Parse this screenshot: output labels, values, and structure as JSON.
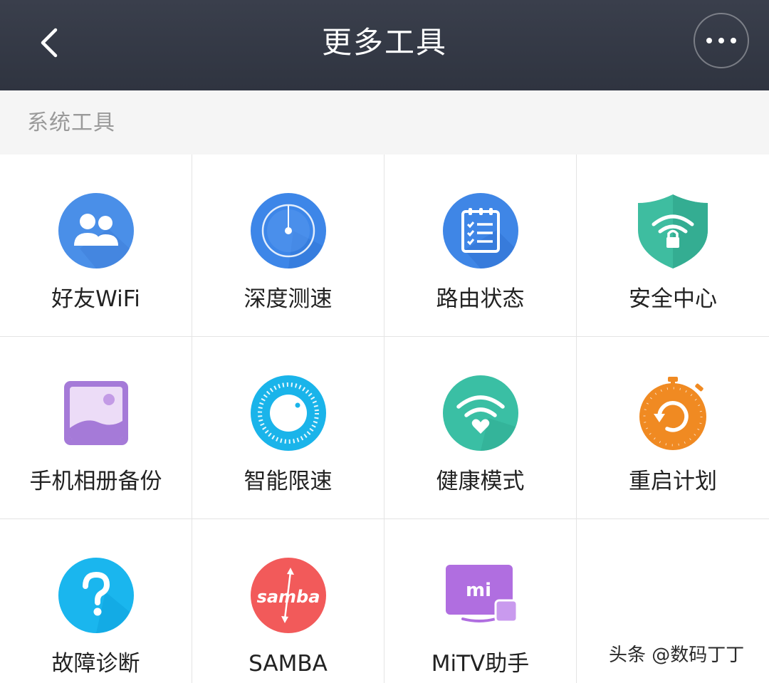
{
  "header": {
    "title": "更多工具"
  },
  "section": {
    "title": "系统工具"
  },
  "tools": [
    {
      "label": "好友WiFi",
      "icon": "friends-icon",
      "color": "#4a8fe8"
    },
    {
      "label": "深度测速",
      "icon": "radar-icon",
      "color": "#3d86e8"
    },
    {
      "label": "路由状态",
      "icon": "clipboard-checklist-icon",
      "color": "#3f86e6"
    },
    {
      "label": "安全中心",
      "icon": "wifi-shield-lock-icon",
      "color": "#3ebda0"
    },
    {
      "label": "手机相册备份",
      "icon": "photo-album-icon",
      "color": "#a57ad8"
    },
    {
      "label": "智能限速",
      "icon": "speed-dial-icon",
      "color": "#1ab4ea"
    },
    {
      "label": "健康模式",
      "icon": "wifi-heart-icon",
      "color": "#3abfa4"
    },
    {
      "label": "重启计划",
      "icon": "restart-timer-icon",
      "color": "#f08a22"
    },
    {
      "label": "故障诊断",
      "icon": "question-icon",
      "color": "#1ab6ee"
    },
    {
      "label": "SAMBA",
      "icon": "samba-icon",
      "icon_text": "samba",
      "color": "#f25a5a"
    },
    {
      "label": "MiTV助手",
      "icon": "mitv-icon",
      "icon_text": "mi",
      "color": "#b06ee0"
    }
  ],
  "watermark": "头条 @数码丁丁"
}
